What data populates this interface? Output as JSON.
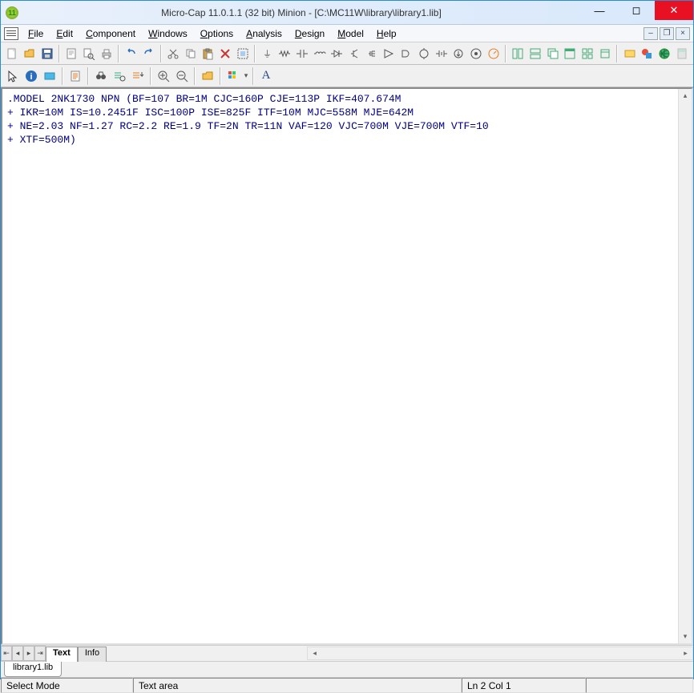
{
  "window": {
    "title": "Micro-Cap 11.0.1.1 (32 bit) Minion - [C:\\MC11W\\library\\library1.lib]"
  },
  "menu": {
    "file": "File",
    "edit": "Edit",
    "component": "Component",
    "windows": "Windows",
    "options": "Options",
    "analysis": "Analysis",
    "design": "Design",
    "model": "Model",
    "help": "Help"
  },
  "editor": {
    "line1": ".MODEL 2NK1730 NPN (BF=107 BR=1M CJC=160P CJE=113P IKF=407.674M",
    "line2": "+ IKR=10M IS=10.2451F ISC=100P ISE=825F ITF=10M MJC=558M MJE=642M",
    "line3": "+ NE=2.03 NF=1.27 RC=2.2 RE=1.9 TF=2N TR=11N VAF=120 VJC=700M VJE=700M VTF=10",
    "line4": "+ XTF=500M)"
  },
  "tabs": {
    "text": "Text",
    "info": "Info"
  },
  "filetab": {
    "name": "library1.lib"
  },
  "status": {
    "mode": "Select Mode",
    "area": "Text area",
    "position": "Ln 2 Col 1"
  }
}
